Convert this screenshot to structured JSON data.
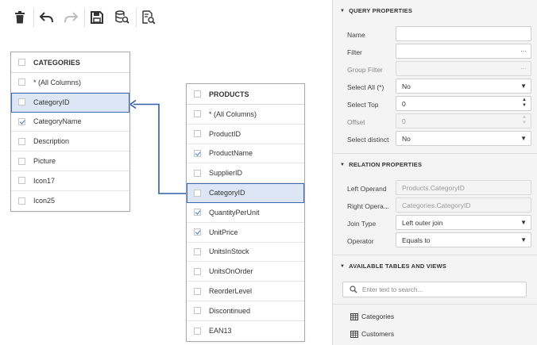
{
  "toolbar": {
    "buttons": [
      {
        "name": "delete-button",
        "icon": "trash-icon"
      },
      {
        "name": "undo-button",
        "icon": "undo-icon"
      },
      {
        "name": "redo-button",
        "icon": "redo-icon"
      },
      {
        "name": "save-button",
        "icon": "save-icon"
      },
      {
        "name": "preview-data-button",
        "icon": "data-preview-icon"
      },
      {
        "name": "preview-query-button",
        "icon": "query-preview-icon"
      }
    ]
  },
  "tables": {
    "categories": {
      "title": "CATEGORIES",
      "rows": [
        {
          "label": "* (All Columns)",
          "checked": false
        },
        {
          "label": "CategoryID",
          "checked": false
        },
        {
          "label": "CategoryName",
          "checked": true
        },
        {
          "label": "Description",
          "checked": false
        },
        {
          "label": "Picture",
          "checked": false
        },
        {
          "label": "Icon17",
          "checked": false
        },
        {
          "label": "Icon25",
          "checked": false
        }
      ]
    },
    "products": {
      "title": "PRODUCTS",
      "rows": [
        {
          "label": "* (All Columns)",
          "checked": false
        },
        {
          "label": "ProductID",
          "checked": false
        },
        {
          "label": "ProductName",
          "checked": true
        },
        {
          "label": "SupplierID",
          "checked": false
        },
        {
          "label": "CategoryID",
          "checked": false
        },
        {
          "label": "QuantityPerUnit",
          "checked": true
        },
        {
          "label": "UnitPrice",
          "checked": true
        },
        {
          "label": "UnitsInStock",
          "checked": false
        },
        {
          "label": "UnitsOnOrder",
          "checked": false
        },
        {
          "label": "ReorderLevel",
          "checked": false
        },
        {
          "label": "Discontinued",
          "checked": false
        },
        {
          "label": "EAN13",
          "checked": false
        }
      ]
    }
  },
  "query_properties": {
    "title": "QUERY PROPERTIES",
    "name_label": "Name",
    "name_value": "",
    "filter_label": "Filter",
    "filter_value": "",
    "group_filter_label": "Group Filter",
    "group_filter_value": "",
    "select_all_label": "Select All (*)",
    "select_all_value": "No",
    "select_top_label": "Select Top",
    "select_top_value": "0",
    "offset_label": "Offset",
    "offset_value": "0",
    "select_distinct_label": "Select distinct",
    "select_distinct_value": "No"
  },
  "relation_properties": {
    "title": "RELATION PROPERTIES",
    "left_operand_label": "Left Operand",
    "left_operand_value": "Products.CategoryID",
    "right_operand_label": "Right Opera...",
    "right_operand_value": "Categories.CategoryID",
    "join_type_label": "Join Type",
    "join_type_value": "Left outer join",
    "operator_label": "Operator",
    "operator_value": "Equals to"
  },
  "tables_and_views": {
    "title": "AVAILABLE TABLES AND VIEWS",
    "search_placeholder": "Enter text to search...",
    "items": [
      "Categories",
      "Customers"
    ]
  },
  "colors": {
    "accent": "#2f5ea8",
    "selection": "#dce6f4",
    "panel_bg": "#f4f4f4"
  }
}
